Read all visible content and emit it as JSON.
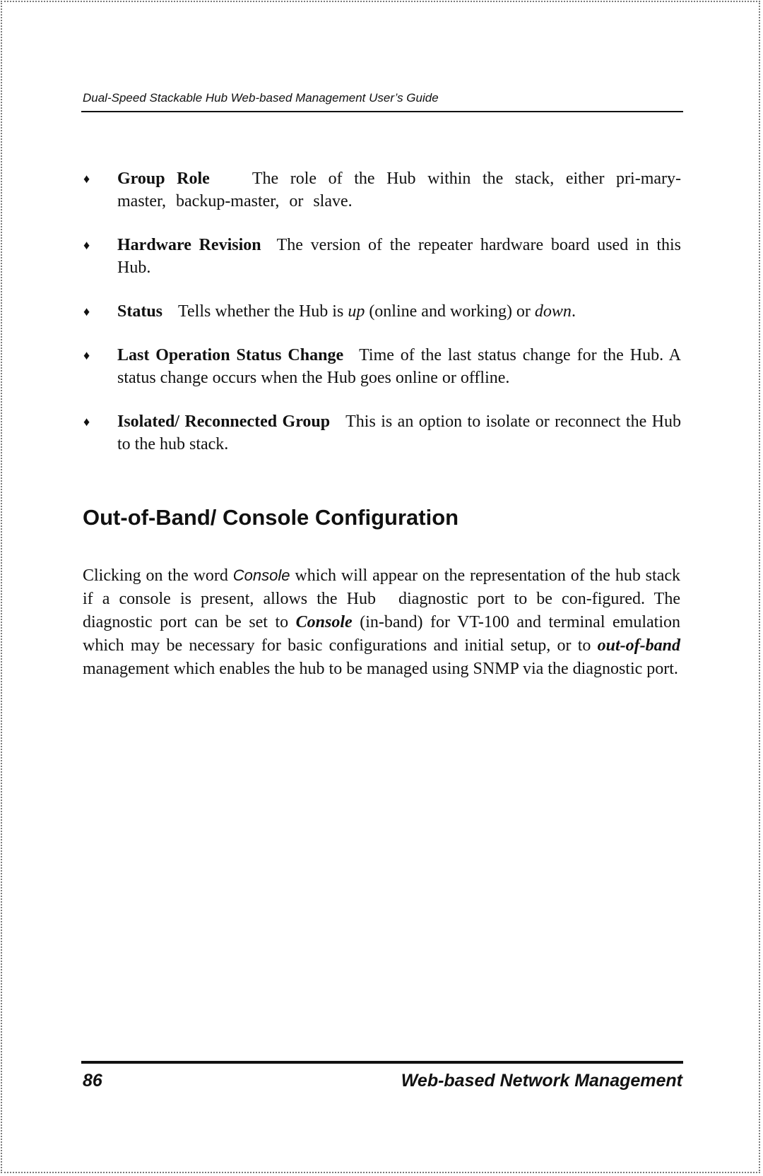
{
  "header": {
    "running_title": "Dual-Speed Stackable Hub Web-based Management User’s Guide"
  },
  "bullets": [
    {
      "term": "Group Role",
      "parts": [
        {
          "text": "The role of the Hub within the stack, either pri-mary-master, backup-master, or slave."
        }
      ]
    },
    {
      "term": "Hardware Revision",
      "parts": [
        {
          "text": "The version of the repeater hardware board used in this Hub."
        }
      ]
    },
    {
      "term": "Status",
      "parts": [
        {
          "text": "Tells whether the Hub is "
        },
        {
          "text": "up",
          "italic": true
        },
        {
          "text": " (online and working) or "
        },
        {
          "text": "down",
          "italic": true
        },
        {
          "text": "."
        }
      ]
    },
    {
      "term": "Last Operation Status Change",
      "parts": [
        {
          "text": "Time of the last status change for the Hub.  A status change occurs when the Hub goes online or offline."
        }
      ]
    },
    {
      "term": "Isolated/ Reconnected Group",
      "parts": [
        {
          "text": "This is an option to isolate or reconnect the Hub to the hub stack."
        }
      ]
    }
  ],
  "section": {
    "heading": "Out-of-Band/ Console Configuration",
    "paragraph": {
      "p1": "Clicking on the word ",
      "console_word": "Console",
      "p2": " which will appear on the representation of the hub stack if a console is present, allows the Hub",
      "p3": "diagnostic port to be con-figured. The diagnostic port can be set to ",
      "console_bold": "Console",
      "p4": " (in-band) for VT-100 and terminal emulation which may be necessary for basic configurations and initial setup, or to ",
      "oob_bold": "out-of-band",
      "p5": " management which enables the hub to be managed using SNMP via the diagnostic port."
    }
  },
  "footer": {
    "page_number": "86",
    "chapter_title": "Web-based Network Management"
  },
  "bullet_glyph": "♦"
}
